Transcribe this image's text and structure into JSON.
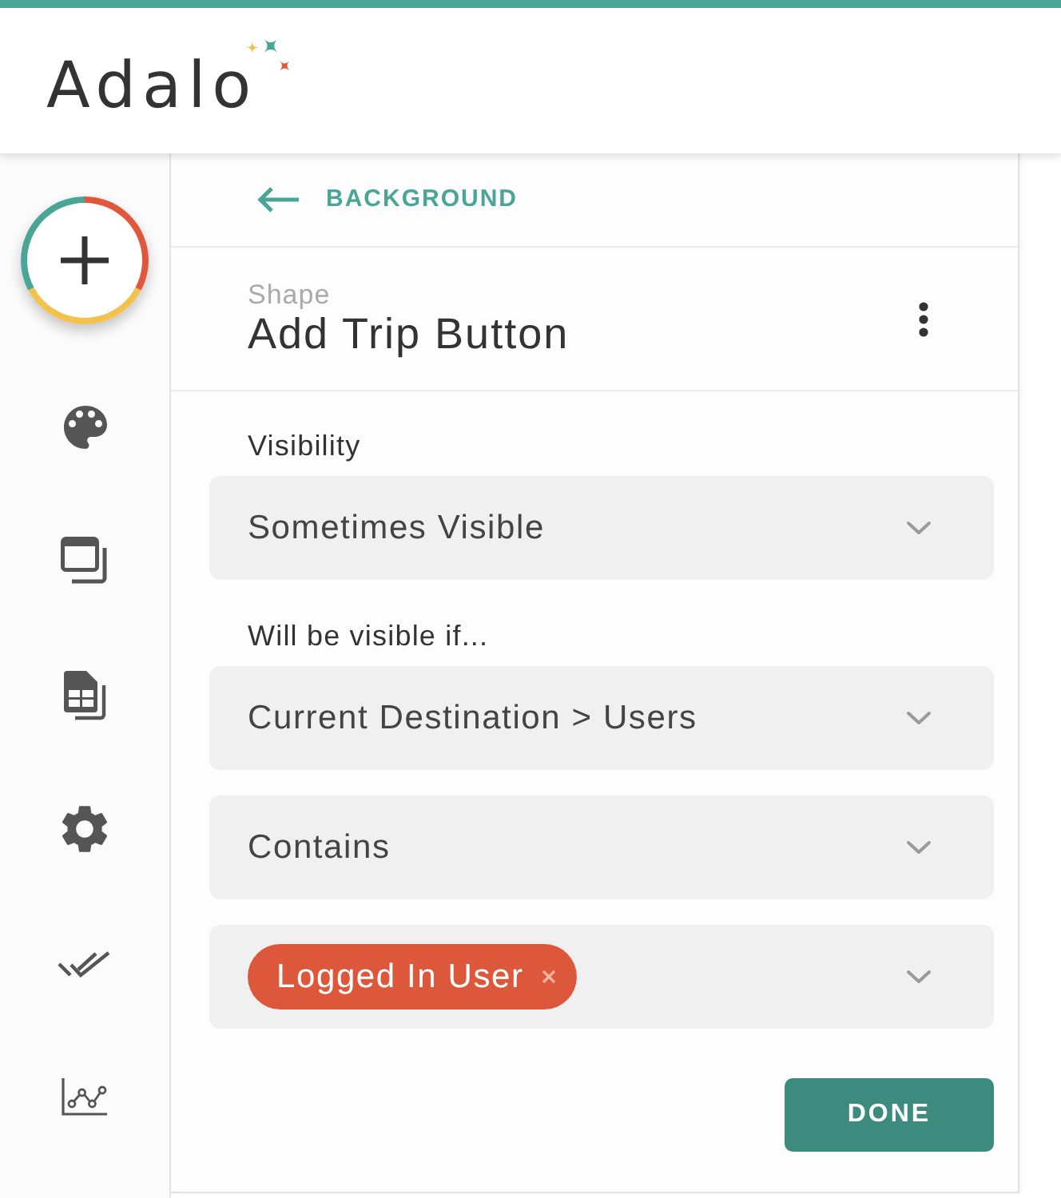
{
  "header": {
    "logo": "Adalo"
  },
  "panel": {
    "back_link": "BACKGROUND",
    "subtitle": "Shape",
    "title": "Add Trip Button",
    "fields": [
      {
        "kind": "label",
        "text": "Visibility"
      },
      {
        "kind": "select",
        "value": "Sometimes Visible"
      },
      {
        "kind": "label",
        "text": "Will be visible if..."
      },
      {
        "kind": "select",
        "value": "Current Destination > Users"
      },
      {
        "kind": "select",
        "value": "Contains"
      },
      {
        "kind": "tag_select",
        "tags": [
          {
            "label": "Logged In User"
          }
        ]
      }
    ],
    "done_button": "DONE"
  }
}
